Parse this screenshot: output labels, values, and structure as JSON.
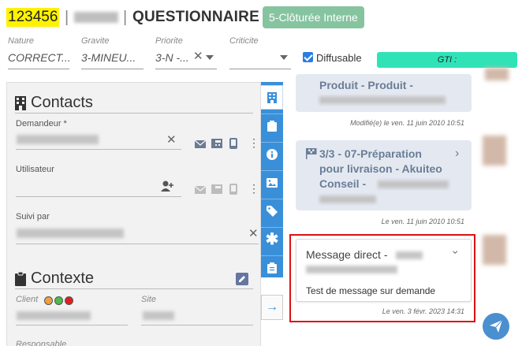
{
  "header": {
    "ticket_id": "123456",
    "separator": "|",
    "title": "QUESTIONNAIRE",
    "status_badge": "5-Clôturée Interne"
  },
  "fields": {
    "nature": {
      "label": "Nature",
      "value": "CORRECT..."
    },
    "gravite": {
      "label": "Gravite",
      "value": "3-MINEU..."
    },
    "priorite": {
      "label": "Priorite",
      "value": "3-N -..."
    },
    "criticite": {
      "label": "Criticite",
      "value": ""
    },
    "diffusable": {
      "label": "Diffusable",
      "checked": true
    },
    "gti": {
      "label": "GTI :"
    }
  },
  "contacts": {
    "title": "Contacts",
    "demandeur_label": "Demandeur *",
    "utilisateur_label": "Utilisateur",
    "suivi_label": "Suivi par"
  },
  "contexte": {
    "title": "Contexte",
    "client_label": "Client",
    "site_label": "Site",
    "responsable_label": "Responsable",
    "client_status_colors": [
      "#f0a040",
      "#4cbb4c",
      "#e02020"
    ]
  },
  "tabs": [
    {
      "icon": "building-icon"
    },
    {
      "icon": "clipboard-icon"
    },
    {
      "icon": "info-icon"
    },
    {
      "icon": "image-icon"
    },
    {
      "icon": "tag-icon"
    },
    {
      "icon": "asterisk-icon"
    },
    {
      "icon": "clipboard-list-icon"
    }
  ],
  "messages": [
    {
      "title": "Produit - Produit -",
      "time": "Modifié(e) le ven. 11 juin 2010 10:51"
    },
    {
      "title_line1": "3/3 - 07-Préparation",
      "title_line2": "pour livraison - Akuiteo",
      "title_line3": "Conseil -",
      "time": "Le ven. 11 juin 2010 10:51"
    },
    {
      "title": "Message direct -",
      "body": "Test de message sur demande",
      "time": "Le ven. 3 févr. 2023 14:31"
    }
  ],
  "colors": {
    "accent": "#3a8fd9",
    "status_badge": "#86c4a0",
    "gti": "#30e3b7",
    "highlight": "#dd1111"
  }
}
